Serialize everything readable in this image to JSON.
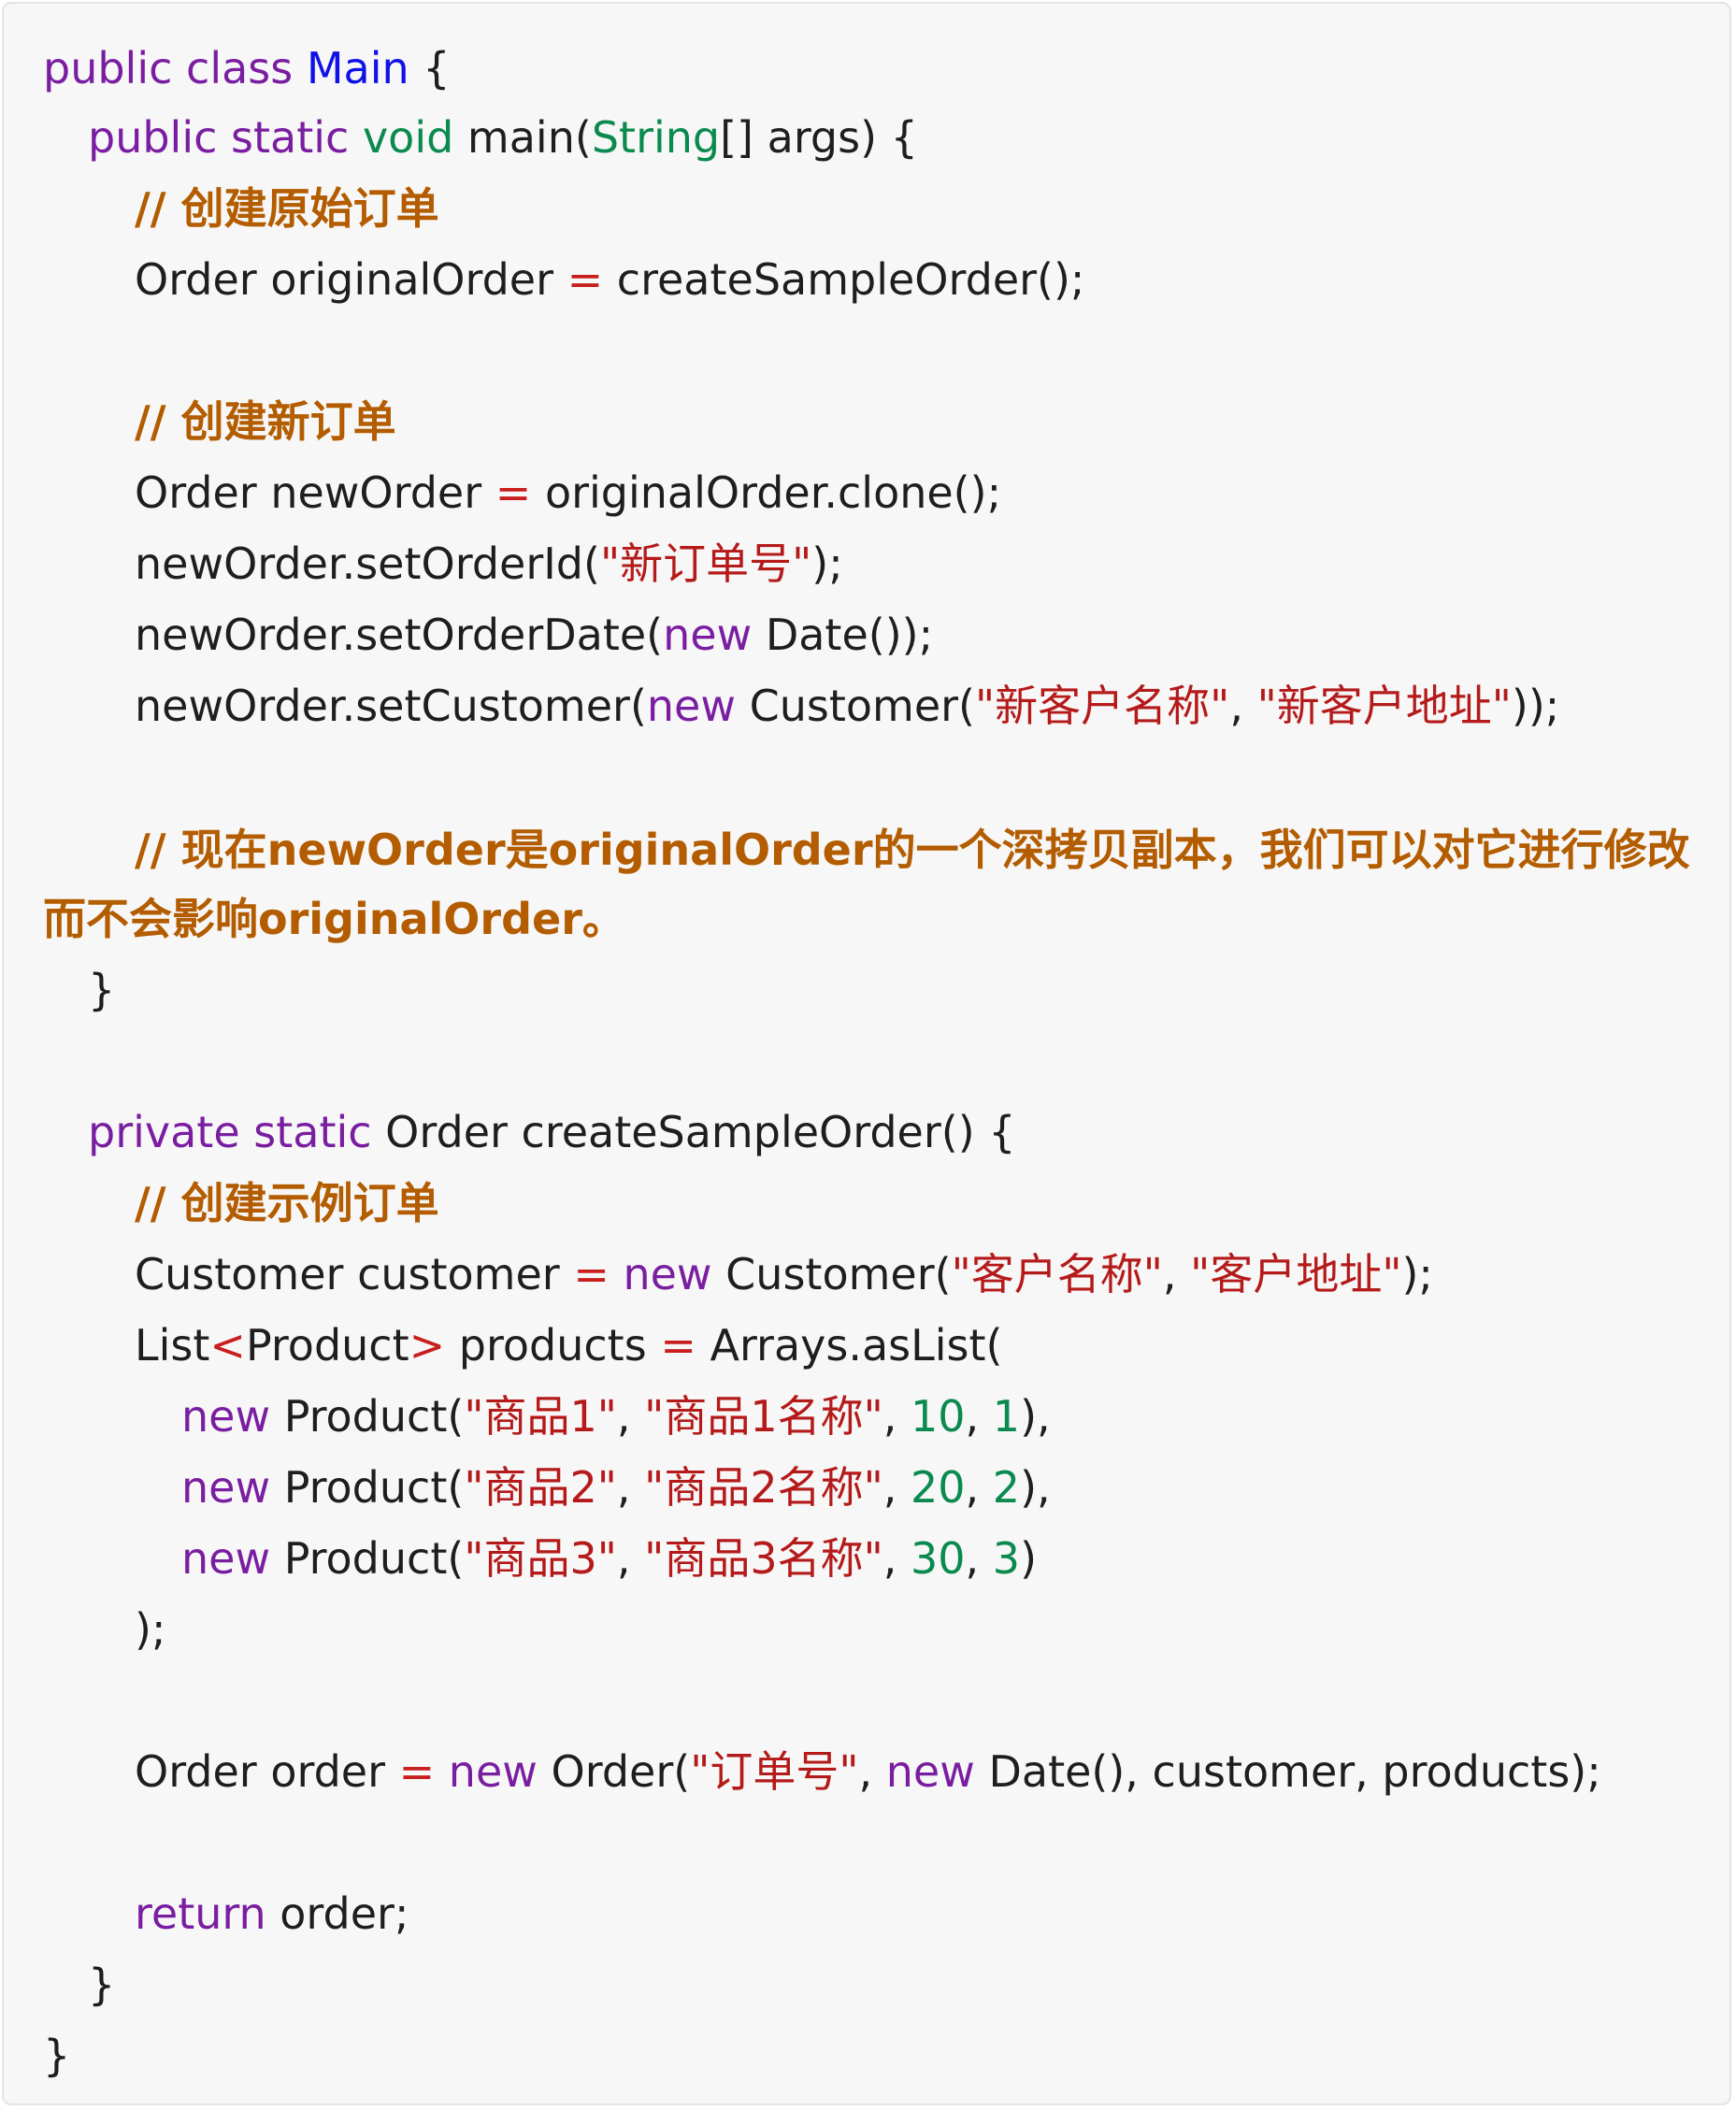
{
  "code": {
    "l1": {
      "kw": "public class ",
      "cls": "Main",
      "rest": " {"
    },
    "l2": {
      "kw": "public static ",
      "type": "void",
      "a": " main(",
      "str_type": "String",
      "b": "[] args) {"
    },
    "l3": {
      "comment": "// 创建原始订单"
    },
    "l4": {
      "a": "Order originalOrder ",
      "op": "=",
      "b": " createSampleOrder();"
    },
    "l5": {
      "comment": "// 创建新订单"
    },
    "l6": {
      "a": "Order newOrder ",
      "op": "=",
      "b": " originalOrder.clone();"
    },
    "l7": {
      "a": "newOrder.setOrderId(",
      "s1": "\"新订单号\"",
      "b": ");"
    },
    "l8": {
      "a": "newOrder.setOrderDate(",
      "kw": "new",
      "b": " Date());"
    },
    "l9": {
      "a": "newOrder.setCustomer(",
      "kw": "new",
      "b": " Customer(",
      "s1": "\"新客户名称\"",
      "c": ", ",
      "s2": "\"新客户地址\"",
      "d": "));"
    },
    "l10": {
      "comment": "// 现在newOrder是originalOrder的一个深拷贝副本，我们可以对它进行修改而不会影响originalOrder。"
    },
    "l11": {
      "a": "}"
    },
    "l12": {
      "kw": "private static",
      "a": " Order createSampleOrder() {"
    },
    "l13": {
      "comment": "// 创建示例订单"
    },
    "l14": {
      "a": "Customer customer ",
      "op": "=",
      "kw": " new",
      "b": " Customer(",
      "s1": "\"客户名称\"",
      "c": ", ",
      "s2": "\"客户地址\"",
      "d": ");"
    },
    "l15": {
      "a": "List",
      "op1": "<",
      "b": "Product",
      "op2": ">",
      "c": " products ",
      "op3": "=",
      "d": " Arrays.asList("
    },
    "l16": {
      "kw": "new",
      "a": " Product(",
      "s1": "\"商品1\"",
      "c": ", ",
      "s2": "\"商品1名称\"",
      "d": ", ",
      "n1": "10",
      "e": ", ",
      "n2": "1",
      "f": "),"
    },
    "l17": {
      "kw": "new",
      "a": " Product(",
      "s1": "\"商品2\"",
      "c": ", ",
      "s2": "\"商品2名称\"",
      "d": ", ",
      "n1": "20",
      "e": ", ",
      "n2": "2",
      "f": "),"
    },
    "l18": {
      "kw": "new",
      "a": " Product(",
      "s1": "\"商品3\"",
      "c": ", ",
      "s2": "\"商品3名称\"",
      "d": ", ",
      "n1": "30",
      "e": ", ",
      "n2": "3",
      "f": ")"
    },
    "l19": {
      "a": ");"
    },
    "l20": {
      "a": "Order order ",
      "op": "=",
      "kw1": " new",
      "b": " Order(",
      "s1": "\"订单号\"",
      "c": ", ",
      "kw2": "new",
      "d": " Date(), customer, products);"
    },
    "l21": {
      "kw": "return",
      "a": " order;"
    },
    "l22": {
      "a": "}"
    },
    "l23": {
      "a": "}"
    }
  },
  "colors": {
    "keyword": "#7a1ea1",
    "type": "#0a8a4e",
    "class_name": "#1010e8",
    "string": "#b51a1a",
    "number": "#0a8a4e",
    "operator": "#c81e1e",
    "comment": "#b35c00",
    "background": "#f7f7f7"
  }
}
